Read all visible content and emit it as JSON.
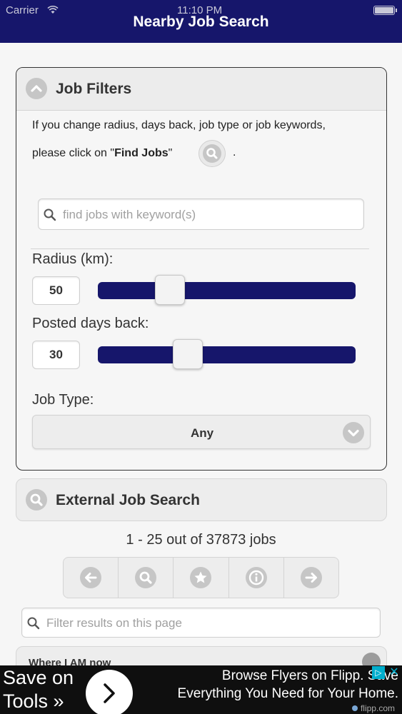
{
  "status_bar": {
    "carrier": "Carrier",
    "time": "11:10 PM"
  },
  "header": {
    "title": "Nearby Job Search"
  },
  "filters": {
    "title": "Job Filters",
    "hint_line1": "If you change radius, days back, job type or job keywords,",
    "hint_line2_prefix": "please click on \"",
    "hint_line2_bold": "Find Jobs",
    "hint_line2_suffix": "\"",
    "hint_end": ".",
    "keyword_placeholder": "find jobs with keyword(s)",
    "radius_label": "Radius (km):",
    "radius_value": "50",
    "radius_fraction": 0.25,
    "days_label": "Posted days back:",
    "days_value": "30",
    "days_fraction": 0.33,
    "job_type_label": "Job Type:",
    "job_type_value": "Any"
  },
  "external": {
    "title": "External Job Search"
  },
  "results": {
    "count_text": "1 - 25 out of 37873 jobs"
  },
  "navbar": {
    "icons": [
      "arrow-left-icon",
      "search-icon",
      "star-icon",
      "info-icon",
      "arrow-right-icon"
    ]
  },
  "filter_results": {
    "placeholder": "Filter results on this page"
  },
  "where": {
    "title": "Where I AM now"
  },
  "ad": {
    "left_line1": "Save on",
    "left_line2": "Tools »",
    "text_line1": "Browse Flyers on Flipp. Save",
    "text_line2": "Everything You Need for Your Home.",
    "domain": "flipp.com"
  },
  "colors": {
    "brand": "#16166b",
    "button_gray": "#c6c6c6"
  }
}
